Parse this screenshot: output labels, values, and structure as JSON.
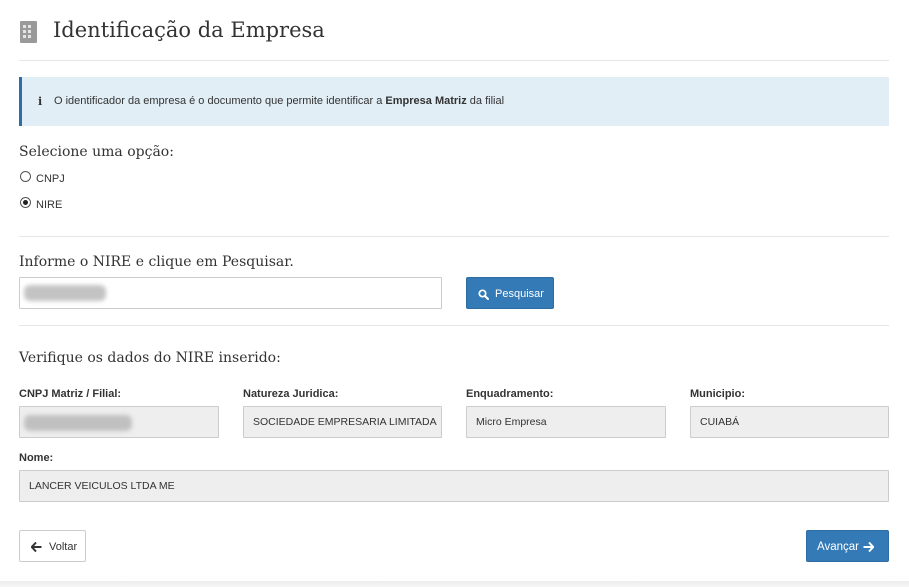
{
  "header": {
    "title": "Identificação da Empresa",
    "icon": "building-icon"
  },
  "info": {
    "icon": "info-icon",
    "text_before": "O identificador da empresa é o documento que permite identificar a ",
    "text_bold": "Empresa Matriz",
    "text_after": " da filial"
  },
  "options": {
    "label": "Selecione uma opção:",
    "items": [
      {
        "label": "CNPJ",
        "checked": false
      },
      {
        "label": "NIRE",
        "checked": true
      }
    ]
  },
  "search": {
    "label": "Informe o NIRE e clique em Pesquisar.",
    "value": "",
    "button_icon": "search-icon",
    "button_label": "Pesquisar"
  },
  "verify": {
    "label": "Verifique os dados do NIRE inserido:",
    "fields": {
      "cnpj": {
        "label": "CNPJ Matriz / Filial:",
        "value": ""
      },
      "natureza": {
        "label": "Natureza Juridica:",
        "value": "SOCIEDADE EMPRESARIA LIMITADA"
      },
      "enquadramento": {
        "label": "Enquadramento:",
        "value": "Micro Empresa"
      },
      "municipio": {
        "label": "Municipio:",
        "value": "CUIABÁ"
      },
      "nome": {
        "label": "Nome:",
        "value": "LANCER VEICULOS LTDA ME"
      }
    }
  },
  "nav": {
    "back_label": "Voltar",
    "back_icon": "arrow-left-icon",
    "next_label": "Avançar",
    "next_icon": "arrow-right-icon"
  },
  "colors": {
    "primary": "#337ab7",
    "info_bg": "#e1eef6",
    "info_border": "#2c6fa8",
    "readonly_bg": "#eeeeee"
  }
}
